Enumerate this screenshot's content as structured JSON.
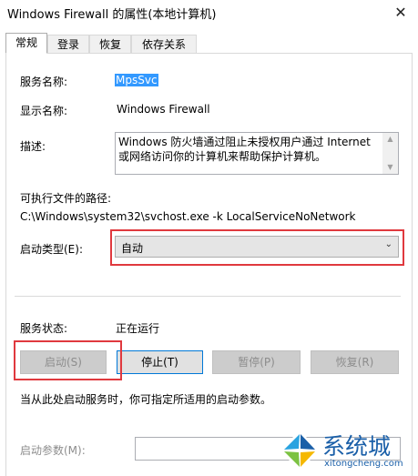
{
  "window": {
    "title": "Windows Firewall 的属性(本地计算机)",
    "close_glyph": "✕"
  },
  "tabs": [
    {
      "label": "常规",
      "active": true
    },
    {
      "label": "登录",
      "active": false
    },
    {
      "label": "恢复",
      "active": false
    },
    {
      "label": "依存关系",
      "active": false
    }
  ],
  "general": {
    "service_name_label": "服务名称:",
    "service_name_value": "MpsSvc",
    "display_name_label": "显示名称:",
    "display_name_value": "Windows Firewall",
    "description_label": "描述:",
    "description_value": "Windows 防火墙通过阻止未授权用户通过 Internet 或网络访问你的计算机来帮助保护计算机。",
    "exe_path_label": "可执行文件的路径:",
    "exe_path_value": "C:\\Windows\\system32\\svchost.exe -k LocalServiceNoNetwork",
    "startup_type_label": "启动类型(E):",
    "startup_type_value": "自动",
    "service_status_label": "服务状态:",
    "service_status_value": "正在运行",
    "buttons": {
      "start": "启动(S)",
      "stop": "停止(T)",
      "pause": "暂停(P)",
      "resume": "恢复(R)"
    },
    "hint": "当从此处启动服务时，你可指定所适用的启动参数。",
    "start_params_label": "启动参数(M):",
    "start_params_value": ""
  },
  "watermark": {
    "brand": "系统城",
    "url": "xitongcheng.com",
    "colors": {
      "blue": "#1a5fa8",
      "light_blue": "#29a3e0",
      "green": "#7cc242",
      "yellow": "#f5b800"
    }
  },
  "colors": {
    "highlight": "#e0393e",
    "selection": "#3399ff"
  }
}
